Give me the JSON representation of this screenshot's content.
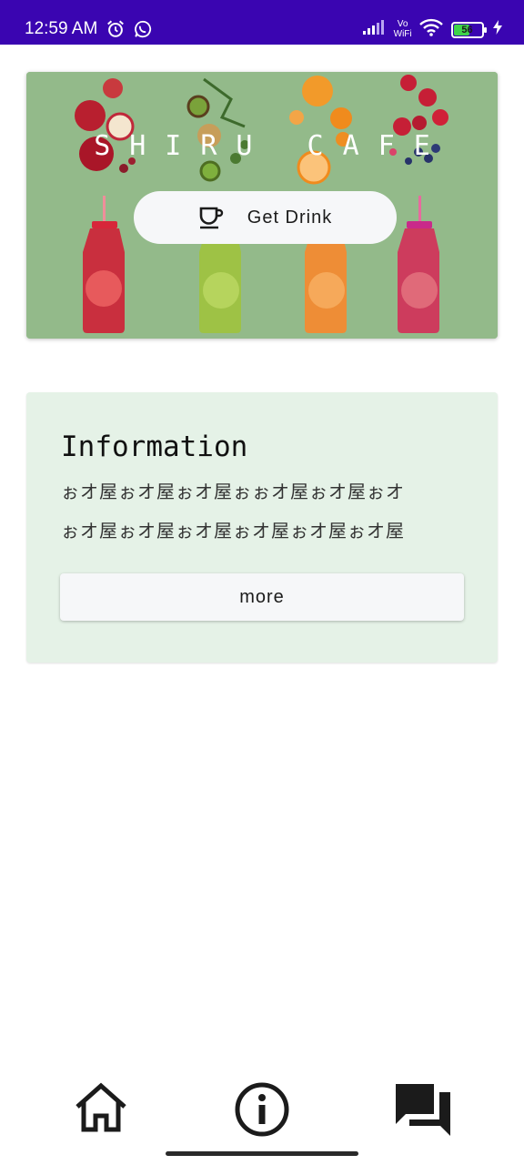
{
  "status_bar": {
    "time": "12:59 AM",
    "icons": [
      "alarm-icon",
      "whatsapp-icon",
      "signal-icon",
      "vowifi-icon",
      "wifi-icon",
      "battery-icon",
      "charging-icon"
    ],
    "vowifi_top": "Vo",
    "vowifi_bottom": "WiFi",
    "battery_level": "56",
    "battery_fraction": 0.56,
    "background_color": "#3a05b1"
  },
  "hero": {
    "title": "SHIRU CAFE",
    "get_drink_label": "Get Drink",
    "get_drink_icon": "cup-icon",
    "background_color": "#93ba8a"
  },
  "info": {
    "title": "Information",
    "body_line_1": "ぉオ屋ぉオ屋ぉオ屋ぉぉオ屋ぉオ屋ぉオ",
    "body_line_2": "ぉオ屋ぉオ屋ぉオ屋ぉオ屋ぉオ屋ぉオ屋",
    "more_label": "more",
    "background_color": "#e5f2e7"
  },
  "bottom_nav": {
    "items": [
      {
        "icon": "home-icon"
      },
      {
        "icon": "info-icon"
      },
      {
        "icon": "forum-icon"
      }
    ]
  }
}
